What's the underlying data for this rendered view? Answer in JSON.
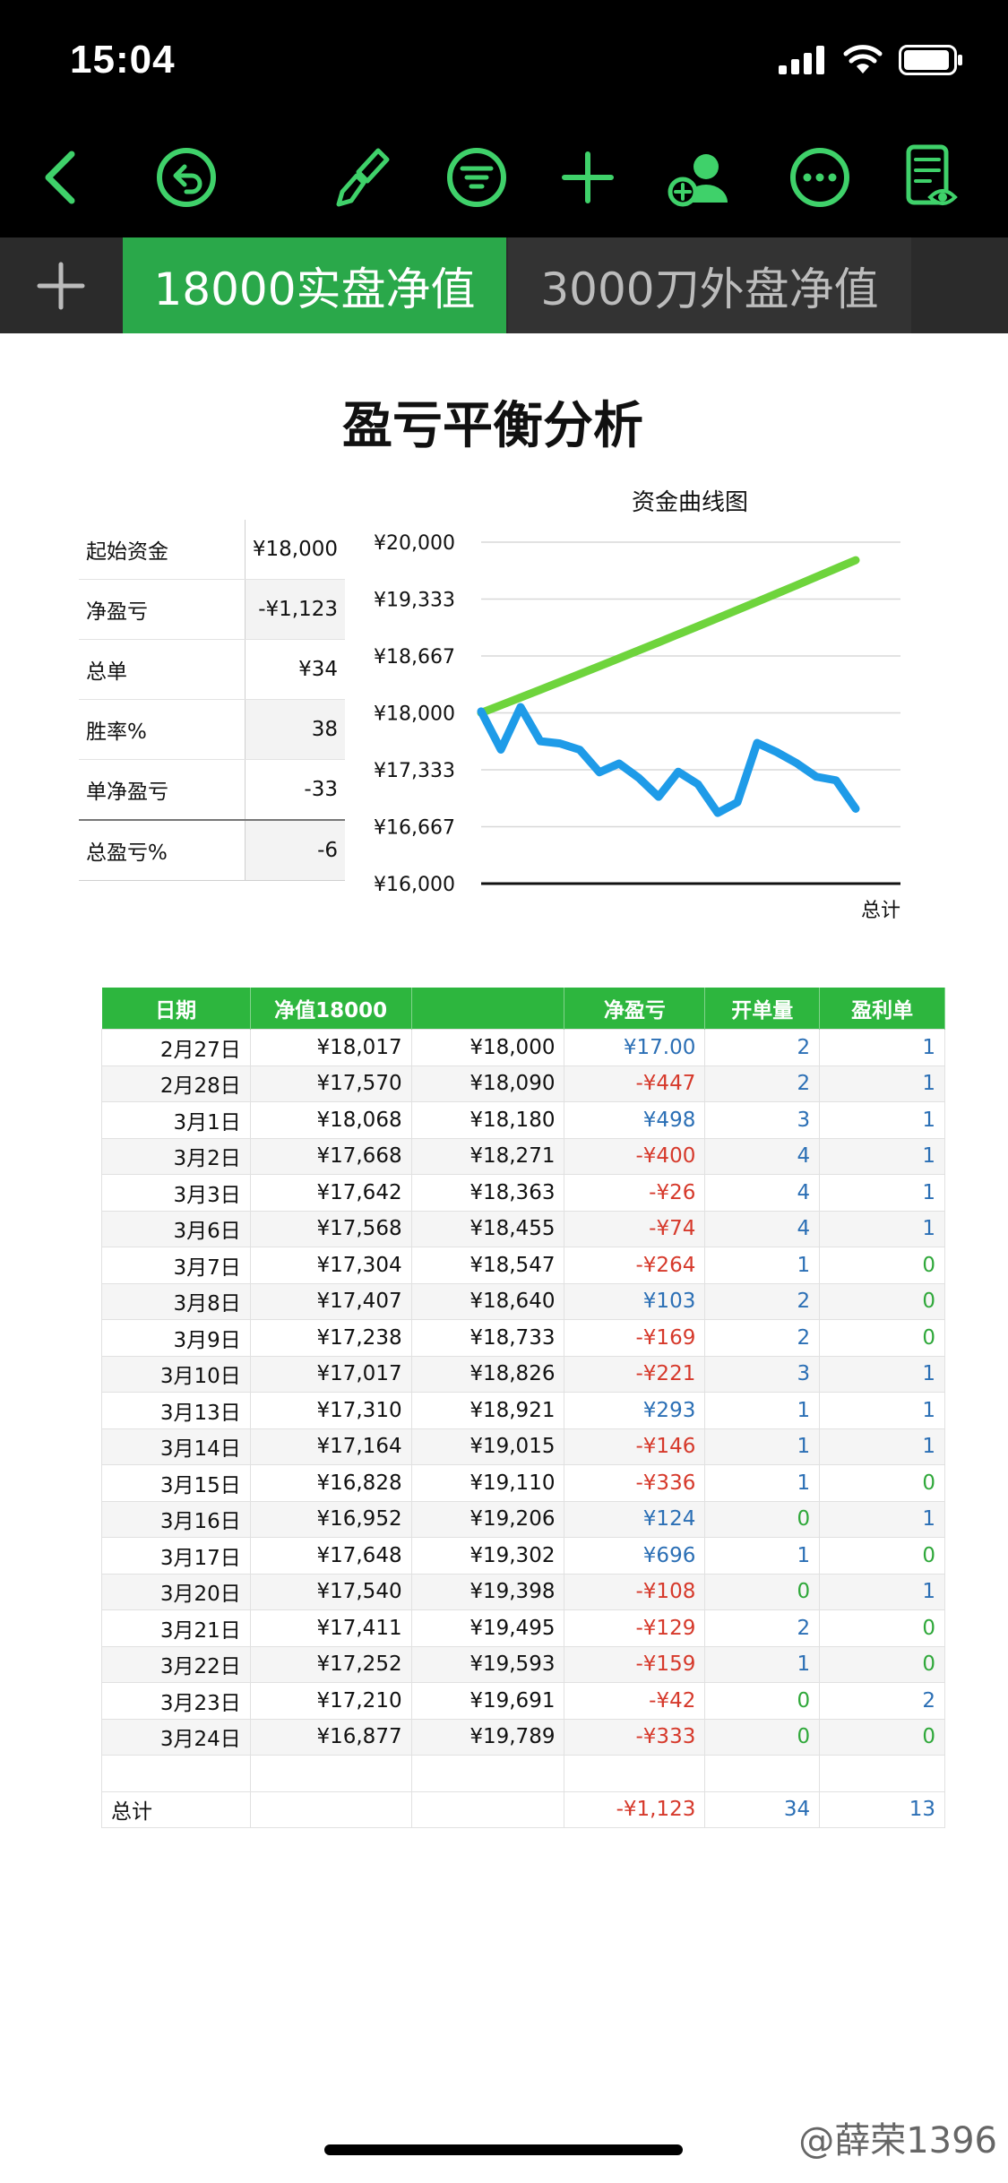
{
  "status": {
    "time": "15:04"
  },
  "tabs": [
    {
      "label": "18000实盘净值",
      "active": true
    },
    {
      "label": "3000刀外盘净值",
      "active": false
    }
  ],
  "title": "盈亏平衡分析",
  "summary": [
    {
      "label": "起始资金",
      "value": "¥18,000"
    },
    {
      "label": "净盈亏",
      "value": "-¥1,123"
    },
    {
      "label": "总单",
      "value": "¥34"
    },
    {
      "label": "胜率%",
      "value": "38"
    },
    {
      "label": "单净盈亏",
      "value": "-33"
    },
    {
      "label": "总盈亏%",
      "value": "-6"
    }
  ],
  "chart_data": {
    "type": "line",
    "title": "资金曲线图",
    "xlabel": "总计",
    "ylim": [
      16000,
      20000
    ],
    "yticks": [
      "¥20,000",
      "¥19,333",
      "¥18,667",
      "¥18,000",
      "¥17,333",
      "¥16,667",
      "¥16,000"
    ],
    "series": [
      {
        "color": "#6ed43c",
        "values": [
          18000,
          18090,
          18180,
          18271,
          18363,
          18455,
          18547,
          18640,
          18733,
          18826,
          18921,
          19015,
          19110,
          19206,
          19302,
          19398,
          19495,
          19593,
          19691,
          19789
        ]
      },
      {
        "color": "#1e9be8",
        "values": [
          18017,
          17570,
          18068,
          17668,
          17642,
          17568,
          17304,
          17407,
          17238,
          17017,
          17310,
          17164,
          16828,
          16952,
          17648,
          17540,
          17411,
          17252,
          17210,
          16877
        ]
      }
    ]
  },
  "table": {
    "headers": [
      "日期",
      "净值18000",
      "",
      "净盈亏",
      "开单量",
      "盈利单"
    ],
    "rows": [
      [
        "2月27日",
        "¥18,017",
        "¥18,000",
        "¥17.00",
        "2",
        "1"
      ],
      [
        "2月28日",
        "¥17,570",
        "¥18,090",
        "-¥447",
        "2",
        "1"
      ],
      [
        "3月1日",
        "¥18,068",
        "¥18,180",
        "¥498",
        "3",
        "1"
      ],
      [
        "3月2日",
        "¥17,668",
        "¥18,271",
        "-¥400",
        "4",
        "1"
      ],
      [
        "3月3日",
        "¥17,642",
        "¥18,363",
        "-¥26",
        "4",
        "1"
      ],
      [
        "3月6日",
        "¥17,568",
        "¥18,455",
        "-¥74",
        "4",
        "1"
      ],
      [
        "3月7日",
        "¥17,304",
        "¥18,547",
        "-¥264",
        "1",
        "0"
      ],
      [
        "3月8日",
        "¥17,407",
        "¥18,640",
        "¥103",
        "2",
        "0"
      ],
      [
        "3月9日",
        "¥17,238",
        "¥18,733",
        "-¥169",
        "2",
        "0"
      ],
      [
        "3月10日",
        "¥17,017",
        "¥18,826",
        "-¥221",
        "3",
        "1"
      ],
      [
        "3月13日",
        "¥17,310",
        "¥18,921",
        "¥293",
        "1",
        "1"
      ],
      [
        "3月14日",
        "¥17,164",
        "¥19,015",
        "-¥146",
        "1",
        "1"
      ],
      [
        "3月15日",
        "¥16,828",
        "¥19,110",
        "-¥336",
        "1",
        "0"
      ],
      [
        "3月16日",
        "¥16,952",
        "¥19,206",
        "¥124",
        "0",
        "1"
      ],
      [
        "3月17日",
        "¥17,648",
        "¥19,302",
        "¥696",
        "1",
        "0"
      ],
      [
        "3月20日",
        "¥17,540",
        "¥19,398",
        "-¥108",
        "0",
        "1"
      ],
      [
        "3月21日",
        "¥17,411",
        "¥19,495",
        "-¥129",
        "2",
        "0"
      ],
      [
        "3月22日",
        "¥17,252",
        "¥19,593",
        "-¥159",
        "1",
        "0"
      ],
      [
        "3月23日",
        "¥17,210",
        "¥19,691",
        "-¥42",
        "0",
        "2"
      ],
      [
        "3月24日",
        "¥16,877",
        "¥19,789",
        "-¥333",
        "0",
        "0"
      ]
    ],
    "total": [
      "总计",
      "",
      "",
      "-¥1,123",
      "34",
      "13"
    ]
  },
  "watermark": "@薛荣1396"
}
